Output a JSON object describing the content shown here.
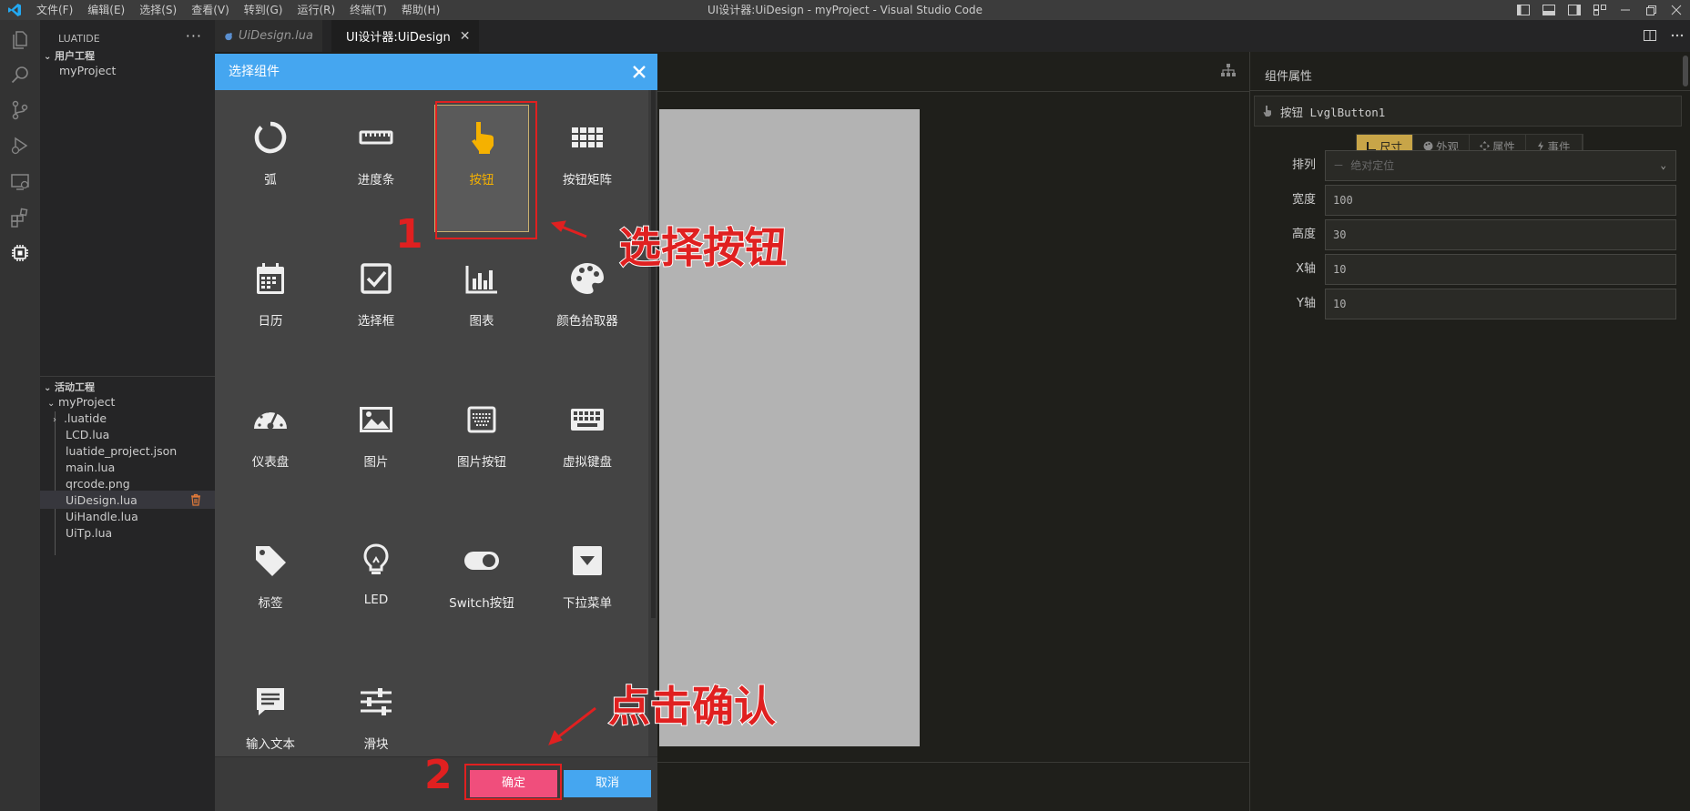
{
  "window": {
    "title": "UI设计器:UiDesign - myProject - Visual Studio Code",
    "menu": [
      "文件(F)",
      "编辑(E)",
      "选择(S)",
      "查看(V)",
      "转到(G)",
      "运行(R)",
      "终端(T)",
      "帮助(H)"
    ]
  },
  "activity_bar": [
    "files-icon",
    "search-icon",
    "source-control-icon",
    "run-debug-icon",
    "remote-explorer-icon",
    "extensions-icon",
    "luatide-chip-icon"
  ],
  "sidebar": {
    "header": "LUATIDE",
    "more": "···",
    "user_section": "用户工程",
    "user_project": "myProject",
    "active_section": "活动工程",
    "active_project": "myProject",
    "files": [
      ".luatide",
      "LCD.lua",
      "luatide_project.json",
      "main.lua",
      "qrcode.png",
      "UiDesign.lua",
      "UiHandle.lua",
      "UiTp.lua"
    ],
    "selected_file": "UiDesign.lua"
  },
  "tabs": [
    {
      "label": "UiDesign.lua",
      "active": false
    },
    {
      "label": "UI设计器:UiDesign",
      "active": true
    }
  ],
  "dialog": {
    "title": "选择组件",
    "components": [
      {
        "name": "弧",
        "icon": "arc-icon"
      },
      {
        "name": "进度条",
        "icon": "progress-bar-icon"
      },
      {
        "name": "按钮",
        "icon": "hand-pointer-icon",
        "selected": true
      },
      {
        "name": "按钮矩阵",
        "icon": "button-matrix-icon"
      },
      {
        "name": "日历",
        "icon": "calendar-icon"
      },
      {
        "name": "选择框",
        "icon": "checkbox-icon"
      },
      {
        "name": "图表",
        "icon": "chart-icon"
      },
      {
        "name": "颜色拾取器",
        "icon": "color-picker-icon"
      },
      {
        "name": "仪表盘",
        "icon": "gauge-icon"
      },
      {
        "name": "图片",
        "icon": "image-icon"
      },
      {
        "name": "图片按钮",
        "icon": "image-button-icon"
      },
      {
        "name": "虚拟键盘",
        "icon": "keyboard-icon"
      },
      {
        "name": "标签",
        "icon": "tag-icon"
      },
      {
        "name": "LED",
        "icon": "led-bulb-icon"
      },
      {
        "name": "Switch按钮",
        "icon": "switch-icon"
      },
      {
        "name": "下拉菜单",
        "icon": "dropdown-icon"
      },
      {
        "name": "输入文本",
        "icon": "text-input-icon"
      },
      {
        "name": "滑块",
        "icon": "slider-icon"
      }
    ],
    "ok": "确定",
    "cancel": "取消"
  },
  "annotations": {
    "step1_number": "1",
    "step1_text": "选择按钮",
    "step2_number": "2",
    "step2_text": "点击确认",
    "color": "#e02020"
  },
  "properties": {
    "header": "组件属性",
    "component": "按钮 LvglButton1",
    "tabs": [
      "尺寸",
      "外观",
      "属性",
      "事件"
    ],
    "active_tab": "尺寸",
    "rows": [
      {
        "label": "排列",
        "value": "－ 绝对定位",
        "type": "select"
      },
      {
        "label": "宽度",
        "value": "100"
      },
      {
        "label": "高度",
        "value": "30"
      },
      {
        "label": "X轴",
        "value": "10"
      },
      {
        "label": "Y轴",
        "value": "10"
      }
    ]
  },
  "colors": {
    "dialog_header": "#45a6f0",
    "ok_button": "#f04e7c",
    "cancel_button": "#45a6f0",
    "selected_text": "#f5b100",
    "active_prop_tab": "#c8a548",
    "canvas": "#b3b3b3"
  }
}
